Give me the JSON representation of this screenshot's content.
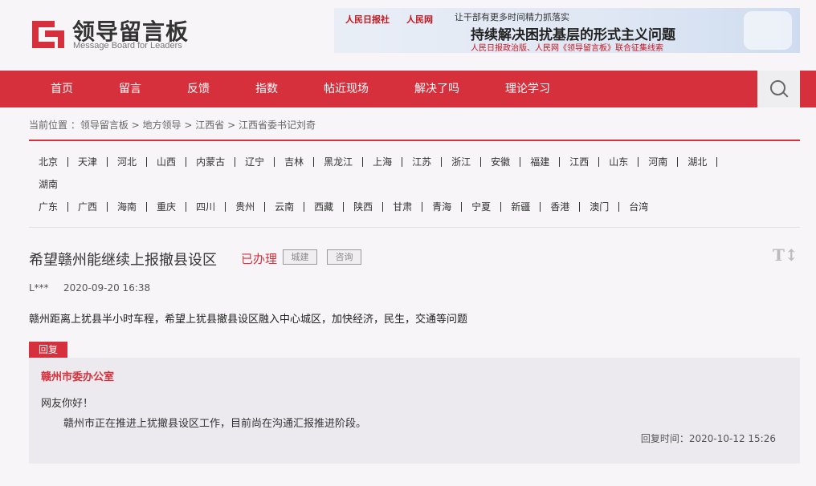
{
  "header": {
    "logo_title": "领导留言板",
    "logo_subtitle": "Message Board for Leaders",
    "banner": {
      "logo_a": "人民日报社",
      "logo_b": "人民网",
      "line1": "让干部有更多时间精力抓落实",
      "line2": "持续解决困扰基层的形式主义问题",
      "line3": "人民日报政治版、人民网《领导留言板》联合征集线索"
    }
  },
  "nav": {
    "items": [
      "首页",
      "留言",
      "反馈",
      "指数",
      "帖近现场",
      "解决了吗",
      "理论学习"
    ]
  },
  "breadcrumb": {
    "prefix": "当前位置 ：",
    "items": [
      "领导留言板",
      "地方领导",
      "江西省",
      "江西省委书记刘奇"
    ],
    "sep": " > "
  },
  "regions": {
    "row1": [
      "北京",
      "天津",
      "河北",
      "山西",
      "内蒙古",
      "辽宁",
      "吉林",
      "黑龙江",
      "上海",
      "江苏",
      "浙江",
      "安徽",
      "福建",
      "江西",
      "山东",
      "河南",
      "湖北"
    ],
    "row2": [
      "湖南"
    ],
    "row3": [
      "广东",
      "广西",
      "海南",
      "重庆",
      "四川",
      "贵州",
      "云南",
      "西藏",
      "陕西",
      "甘肃",
      "青海",
      "宁夏",
      "新疆",
      "香港",
      "澳门",
      "台湾"
    ]
  },
  "message": {
    "title": "希望赣州能继续上报撤县设区",
    "status": "已办理",
    "tags": [
      "城建",
      "咨询"
    ],
    "font_toggle": "T↕",
    "user": "L***",
    "time": "2020-09-20 16:38",
    "body": "赣州距离上犹县半小时车程，希望上犹县撤县设区融入中心城区，加快经济，民生，交通等问题"
  },
  "reply": {
    "badge": "回复",
    "org": "赣州市委办公室",
    "greeting": "网友你好！",
    "text": "赣州市正在推进上犹撤县设区工作，目前尚在沟通汇报推进阶段。",
    "time": "回复时间：2020-10-12 15:26"
  },
  "colors": {
    "accent": "#d7303d",
    "background": "#f7f5f7",
    "reply_bg": "#eceaee"
  }
}
